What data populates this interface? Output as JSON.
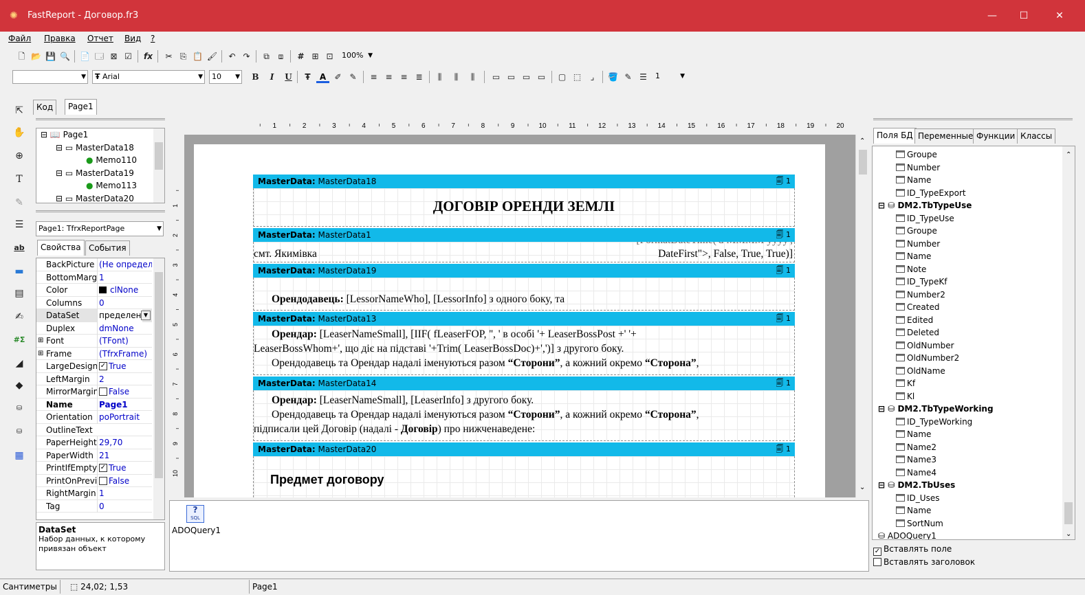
{
  "window": {
    "title": "FastReport - Договор.fr3",
    "minimize": "—",
    "maximize": "☐",
    "close": "✕"
  },
  "menu": [
    "Файл",
    "Правка",
    "Отчет",
    "Вид",
    "?"
  ],
  "toolbar": {
    "zoom": "100%",
    "font_name": "Arial",
    "font_size": "10",
    "line_width": "1",
    "style_combo": ""
  },
  "designer_tabs": {
    "code": "Код",
    "page": "Page1"
  },
  "report_tree": {
    "items": [
      "Page1",
      "MasterData18",
      "Memo110",
      "MasterData19",
      "Memo113",
      "MasterData20"
    ]
  },
  "object_inspector": {
    "selected": "Page1: TfrxReportPage",
    "tab_props": "Свойства",
    "tab_events": "События",
    "rows": [
      {
        "name": "BackPicture",
        "value": "(Не определе"
      },
      {
        "name": "BottomMargin",
        "value": "1"
      },
      {
        "name": "Color",
        "value": "clNone"
      },
      {
        "name": "Columns",
        "value": "0"
      },
      {
        "name": "DataSet",
        "value": "пределен)"
      },
      {
        "name": "Duplex",
        "value": "dmNone"
      },
      {
        "name": "Font",
        "value": "(TFont)"
      },
      {
        "name": "Frame",
        "value": "(TfrxFrame)"
      },
      {
        "name": "LargeDesignH",
        "value": "True"
      },
      {
        "name": "LeftMargin",
        "value": "2"
      },
      {
        "name": "MirrorMargins",
        "value": "False"
      },
      {
        "name": "Name",
        "value": "Page1"
      },
      {
        "name": "Orientation",
        "value": "poPortrait"
      },
      {
        "name": "OutlineText",
        "value": ""
      },
      {
        "name": "PaperHeight",
        "value": "29,70"
      },
      {
        "name": "PaperWidth",
        "value": "21"
      },
      {
        "name": "PrintIfEmpty",
        "value": "True"
      },
      {
        "name": "PrintOnPrevio",
        "value": "False"
      },
      {
        "name": "RightMargin",
        "value": "1"
      },
      {
        "name": "Tag",
        "value": "0"
      }
    ],
    "help_title": "DataSet",
    "help_text": "Набор данных, к которому привязан объект"
  },
  "ruler": [
    "1",
    "2",
    "3",
    "4",
    "5",
    "6",
    "7",
    "8",
    "9",
    "10",
    "11",
    "12",
    "13",
    "14",
    "15",
    "16",
    "17",
    "18",
    "19",
    "20"
  ],
  "vruler": [
    "1",
    "2",
    "3",
    "4",
    "5",
    "6",
    "7",
    "8",
    "9",
    "10"
  ],
  "bands": [
    {
      "kind": "MasterData:",
      "name": "MasterData18",
      "count": "1"
    },
    {
      "kind": "MasterData:",
      "name": "MasterData1",
      "count": "1"
    },
    {
      "kind": "MasterData:",
      "name": "MasterData19",
      "count": "1"
    },
    {
      "kind": "MasterData:",
      "name": "MasterData13",
      "count": "1"
    },
    {
      "kind": "MasterData:",
      "name": "MasterData14",
      "count": "1"
    },
    {
      "kind": "MasterData:",
      "name": "MasterData20",
      "count": "1"
    }
  ],
  "report": {
    "title": "ДОГОВІР ОРЕНДИ ЗЕМЛІ",
    "town": "смт. Якимівка",
    "date_expr_top": "[FormatDateTime('d MMMM yyyy',",
    "date_expr": "DateFirst\">, False, True, True)]",
    "lessor_label": "Орендодавець:",
    "lessor_text": "[LessorNameWho], [LessorInfo] з одного боку, та",
    "lessee_label": "Орендар:",
    "lessee_line1": "[LeaserNameSmall],  [IIF(  fLeaserFOP,  '',  '  в  особі  '+  LeaserBossPost  +'  '+",
    "lessee_line2": "LeaserBossWhom+', що діє на підставі '+Trim( LeaserBossDoc)+',')] з другого боку.",
    "together_1": "Орендодавець та Орендар надалі іменуються разом ",
    "sides": "“Сторони”",
    "together_2": ", а кожний окремо ",
    "side": "“Сторона”",
    "together_3": ",",
    "lessee2_text": "[LeaserNameSmall], [LeaserInfo] з другого боку.",
    "signed_1": "підписали цей Договір (надалі - ",
    "signed_bold": "Договір",
    "signed_2": ") про нижченаведене:",
    "subject": "Предмет договору"
  },
  "datasets": {
    "item": "ADOQuery1",
    "icon_text": "SQL"
  },
  "data_tree": {
    "tabs": [
      "Поля БД",
      "Переменные",
      "Функции",
      "Классы"
    ],
    "rows": [
      {
        "type": "field",
        "text": "Groupe"
      },
      {
        "type": "field",
        "text": "Number"
      },
      {
        "type": "field",
        "text": "Name"
      },
      {
        "type": "field",
        "text": "ID_TypeExport"
      },
      {
        "type": "table",
        "text": "DM2.TbTypeUse"
      },
      {
        "type": "field",
        "text": "ID_TypeUse"
      },
      {
        "type": "field",
        "text": "Groupe"
      },
      {
        "type": "field",
        "text": "Number"
      },
      {
        "type": "field",
        "text": "Name"
      },
      {
        "type": "field",
        "text": "Note"
      },
      {
        "type": "field",
        "text": "ID_TypeKf"
      },
      {
        "type": "field",
        "text": "Number2"
      },
      {
        "type": "field",
        "text": "Created"
      },
      {
        "type": "field",
        "text": "Edited"
      },
      {
        "type": "field",
        "text": "Deleted"
      },
      {
        "type": "field",
        "text": "OldNumber"
      },
      {
        "type": "field",
        "text": "OldNumber2"
      },
      {
        "type": "field",
        "text": "OldName"
      },
      {
        "type": "field",
        "text": "Kf"
      },
      {
        "type": "field",
        "text": "Kl"
      },
      {
        "type": "table",
        "text": "DM2.TbTypeWorking"
      },
      {
        "type": "field",
        "text": "ID_TypeWorking"
      },
      {
        "type": "field",
        "text": "Name"
      },
      {
        "type": "field",
        "text": "Name2"
      },
      {
        "type": "field",
        "text": "Name3"
      },
      {
        "type": "field",
        "text": "Name4"
      },
      {
        "type": "table",
        "text": "DM2.TbUses"
      },
      {
        "type": "field",
        "text": "ID_Uses"
      },
      {
        "type": "field",
        "text": "Name"
      },
      {
        "type": "field",
        "text": "SortNum"
      },
      {
        "type": "table2",
        "text": "ADOQuery1"
      }
    ],
    "insert_field": "Вставлять поле",
    "insert_header": "Вставлять заголовок"
  },
  "status": {
    "units": "Сантиметры",
    "coords": "24,02; 1,53",
    "page": "Page1"
  }
}
